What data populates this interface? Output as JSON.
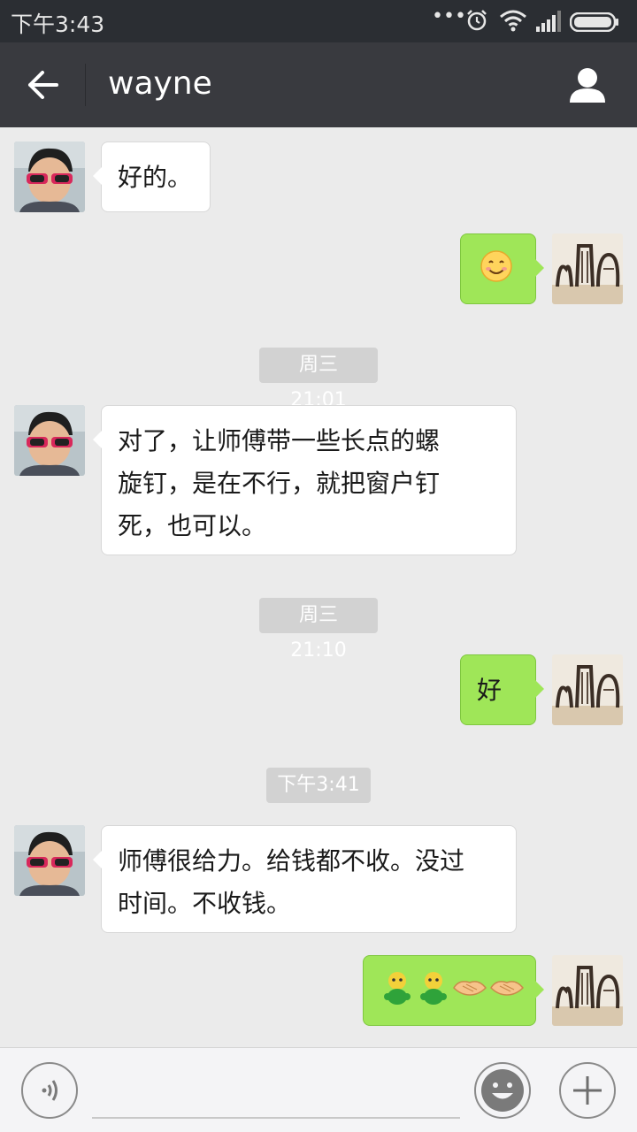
{
  "status_bar": {
    "time": "下午3:43",
    "dots": "•••"
  },
  "header": {
    "title": "wayne"
  },
  "messages": [
    {
      "type": "in",
      "text": "好的。"
    },
    {
      "type": "out",
      "emoji_name": "smile-emoji"
    },
    {
      "type": "time",
      "text": "周三 21:01"
    },
    {
      "type": "in",
      "lines": [
        "对了，让师傅带一些长点的螺",
        "旋钉，是在不行，就把窗户钉",
        "死，也可以。"
      ]
    },
    {
      "type": "time",
      "text": "周三 21:10"
    },
    {
      "type": "out",
      "text": "好"
    },
    {
      "type": "time",
      "text": "下午3:41"
    },
    {
      "type": "in",
      "lines": [
        "师傅很给力。给钱都不收。没过",
        "时间。不收钱。"
      ]
    },
    {
      "type": "out",
      "emoji_names": [
        "green-figure-emoji",
        "green-figure-emoji",
        "handshake-emoji",
        "handshake-emoji"
      ]
    }
  ],
  "colors": {
    "status_bar": "#2b2e33",
    "title_bar": "#393a3f",
    "chat_bg": "#ebebeb",
    "outgoing_bubble": "#9fe658",
    "incoming_bubble": "#ffffff",
    "time_chip": "#d2d2d2"
  }
}
